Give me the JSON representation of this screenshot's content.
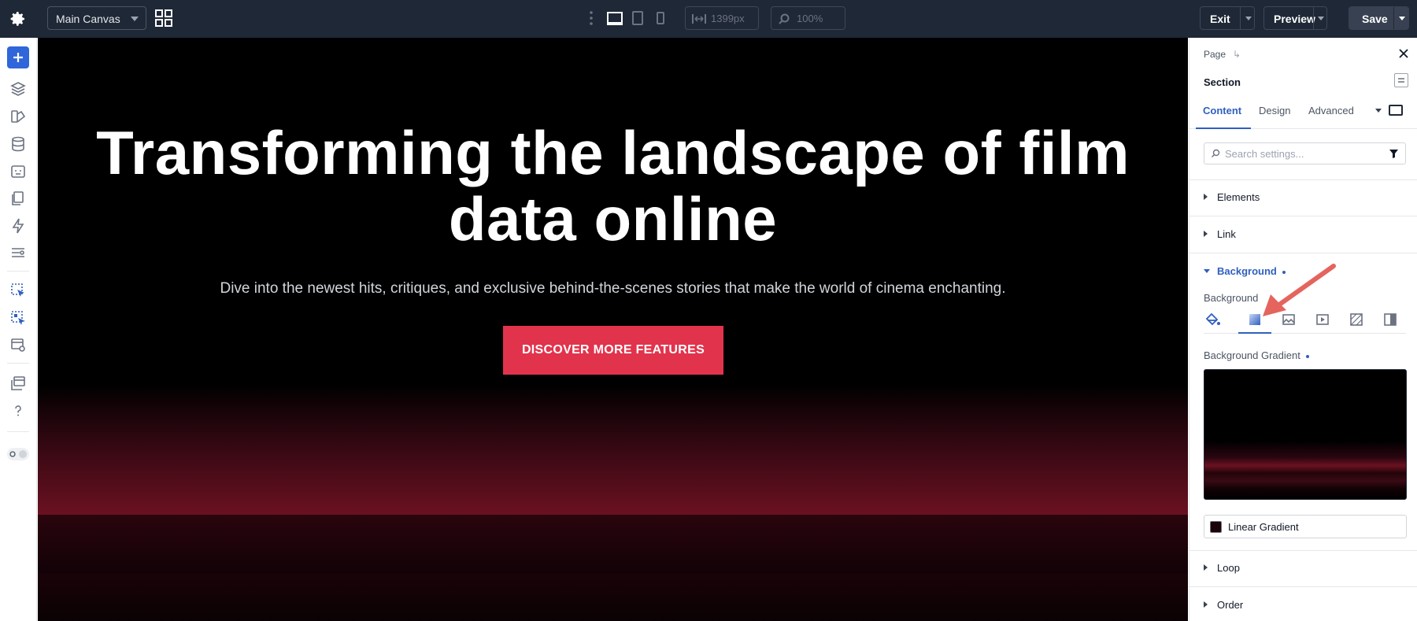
{
  "topbar": {
    "canvas_select": "Main Canvas",
    "width_value": "1399px",
    "zoom_value": "100%",
    "exit_label": "Exit",
    "preview_label": "Preview",
    "save_label": "Save"
  },
  "canvas": {
    "title": "Transforming the landscape of film data online",
    "subtitle": "Dive into the newest hits, critiques, and exclusive behind-the-scenes stories that make the world of cinema enchanting.",
    "cta_label": "DISCOVER MORE FEATURES"
  },
  "panel": {
    "breadcrumb": "Page",
    "breadcrumb_arrow": "↳",
    "section_title": "Section",
    "tabs": [
      {
        "label": "Content",
        "active": true
      },
      {
        "label": "Design",
        "active": false
      },
      {
        "label": "Advanced",
        "active": false
      }
    ],
    "search_placeholder": "Search settings...",
    "accordions": {
      "elements": "Elements",
      "link": "Link",
      "background": "Background",
      "loop": "Loop",
      "order": "Order"
    },
    "background_label": "Background",
    "background_types": [
      "color-icon",
      "gradient-icon",
      "image-icon",
      "video-icon",
      "pattern-icon",
      "mask-icon"
    ],
    "gradient_label": "Background Gradient",
    "gradient_type": "Linear Gradient"
  },
  "colors": {
    "accent": "#2f5fbf",
    "cta": "#e2334c",
    "topbar": "#1f2836",
    "annotation_arrow": "#e5645e"
  }
}
